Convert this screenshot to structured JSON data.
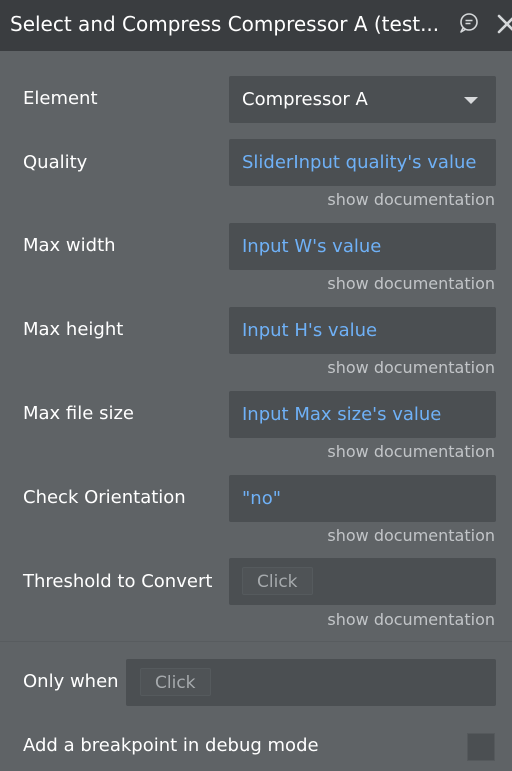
{
  "header": {
    "title": "Select and Compress Compressor A (test...",
    "comment_icon": "comment-icon",
    "close_icon": "close-icon"
  },
  "doc_link_text": "show documentation",
  "fields": {
    "element": {
      "label": "Element",
      "value": "Compressor A"
    },
    "quality": {
      "label": "Quality",
      "value": "SliderInput quality's value"
    },
    "max_width": {
      "label": "Max width",
      "value": "Input W's value"
    },
    "max_height": {
      "label": "Max height",
      "value": "Input H's value"
    },
    "max_file_size": {
      "label": "Max file size",
      "value": "Input Max size's value"
    },
    "check_orientation": {
      "label": "Check Orientation",
      "value": "\"no\""
    },
    "threshold": {
      "label": "Threshold to Convert",
      "button": "Click"
    }
  },
  "only_when": {
    "label": "Only when",
    "button": "Click"
  },
  "breakpoint": {
    "label": "Add a breakpoint in debug mode",
    "checked": false
  },
  "colors": {
    "background": "#5f6366",
    "header": "#3a3d40",
    "field": "#4b4f52",
    "dynamic_text": "#6fb1f7",
    "doc_link": "#c2c5c8"
  }
}
